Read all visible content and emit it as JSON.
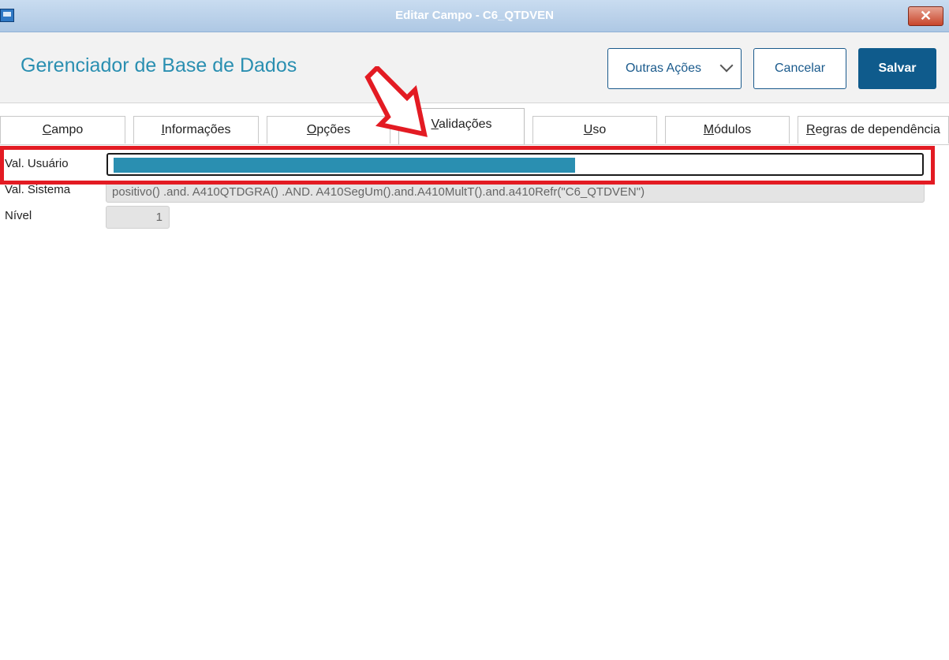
{
  "window": {
    "title": "Editar Campo - C6_QTDVEN",
    "icon": "app-window-icon",
    "close_icon": "close-icon"
  },
  "header": {
    "app_title": "Gerenciador de Base de Dados",
    "actions_label": "Outras Ações",
    "cancel_label": "Cancelar",
    "save_label": "Salvar"
  },
  "tabs": [
    {
      "key": "C",
      "rest": "ampo"
    },
    {
      "key": "I",
      "rest": "nformações"
    },
    {
      "key": "O",
      "rest": "pções"
    },
    {
      "key": "V",
      "rest": "alidações"
    },
    {
      "key": "U",
      "rest": "so"
    },
    {
      "key": "M",
      "rest": "ódulos"
    },
    {
      "key": "R",
      "rest": "egras de dependência"
    }
  ],
  "active_tab": "Validações",
  "form": {
    "val_usuario_label": "Val. Usuário",
    "val_usuario_value": "",
    "val_sistema_label": "Val. Sistema",
    "val_sistema_value": "positivo() .and. A410QTDGRA() .AND. A410SegUm().and.A410MultT().and.a410Refr(\"C6_QTDVEN\")",
    "nivel_label": "Nível",
    "nivel_value": "1"
  },
  "colors": {
    "accent": "#2a8fb1",
    "primary_button": "#0f5b8c",
    "annotation": "#e31b23"
  }
}
